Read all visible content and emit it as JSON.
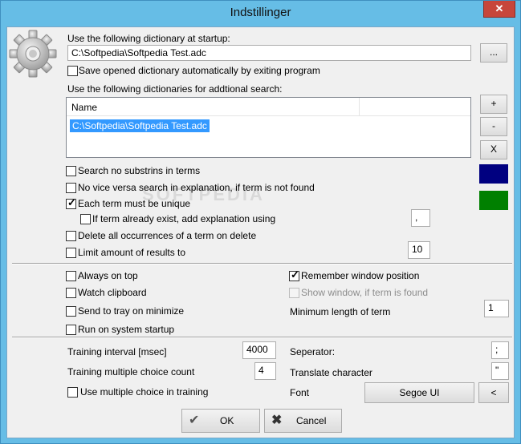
{
  "window": {
    "title": "Indstillinger",
    "close": "✕"
  },
  "startup": {
    "label": "Use the following dictionary at startup:",
    "path": "C:\\Softpedia\\Softpedia Test.adc",
    "browse": "...",
    "save_auto": "Save opened dictionary automatically by exiting program"
  },
  "additional": {
    "label": "Use the following dictionaries for addtional search:",
    "col_name": "Name",
    "items": [
      "C:\\Softpedia\\Softpedia Test.adc"
    ],
    "add": "+",
    "remove": "-",
    "clear": "X"
  },
  "colors": {
    "swatch1": "#000080",
    "swatch2": "#008000",
    "selection": "#3399ff"
  },
  "search": {
    "no_substrings": "Search no substrins in terms",
    "no_vice_versa": "No vice versa search in explanation, if term is not found",
    "unique": "Each term must be unique",
    "if_exist": "If term already exist, add explanation using",
    "if_exist_sep": ",",
    "delete_all": "Delete all occurrences of a term on delete",
    "limit": "Limit amount of results to",
    "limit_value": "10"
  },
  "window_opts": {
    "always_on_top": "Always on top",
    "watch_clipboard": "Watch clipboard",
    "send_to_tray": "Send to tray on minimize",
    "run_startup": "Run on system startup",
    "remember_pos": "Remember window position",
    "show_window": "Show window, if term is found",
    "min_length_label": "Minimum length of term",
    "min_length": "1"
  },
  "training": {
    "interval_label": "Training interval [msec]",
    "interval": "4000",
    "mc_count_label": "Training multiple choice count",
    "mc_count": "4",
    "use_mc": "Use multiple choice in training",
    "separator_label": "Seperator:",
    "separator": ";",
    "translate_label": "Translate character",
    "translate": "\"",
    "font_label": "Font",
    "font_value": "Segoe UI",
    "font_btn": "<"
  },
  "actions": {
    "ok": "OK",
    "cancel": "Cancel"
  },
  "watermark": "SOFTPEDIA"
}
